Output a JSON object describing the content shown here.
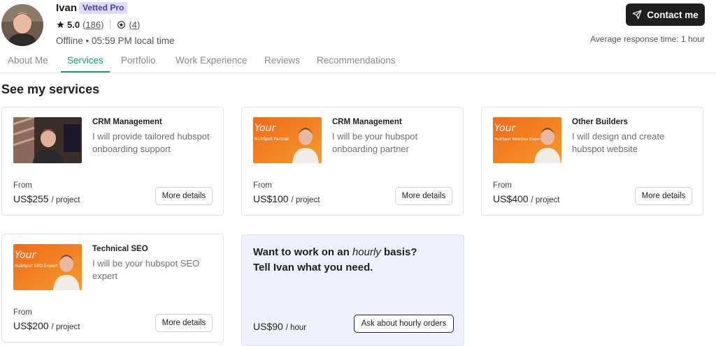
{
  "profile": {
    "name": "Ivan",
    "badge": "Vetted Pro",
    "rating": "5.0",
    "reviews_count": "(186)",
    "badges_count": "(4)",
    "status": "Offline • 05:59 PM local time",
    "contact_label": "Contact me",
    "response_time": "Average response time: 1 hour"
  },
  "tabs": [
    {
      "label": "About Me"
    },
    {
      "label": "Services",
      "active": true
    },
    {
      "label": "Portfolio"
    },
    {
      "label": "Work Experience"
    },
    {
      "label": "Reviews"
    },
    {
      "label": "Recommendations"
    }
  ],
  "section_title": "See my services",
  "services": [
    {
      "category": "CRM Management",
      "description": "I will provide tailored hubspot onboarding support",
      "from": "From",
      "price": "US$255",
      "unit": "/ project",
      "button": "More details",
      "thumb": "photo"
    },
    {
      "category": "CRM Management",
      "description": "I will be your hubspot onboarding partner",
      "from": "From",
      "price": "US$100",
      "unit": "/ project",
      "button": "More details",
      "thumb": "banner",
      "thumb_title": "Your",
      "thumb_subtitle": "HubSpot Partner"
    },
    {
      "category": "Other Builders",
      "description": "I will design and create hubspot website",
      "from": "From",
      "price": "US$400",
      "unit": "/ project",
      "button": "More details",
      "thumb": "banner",
      "thumb_title": "Your",
      "thumb_subtitle": "HubSpot WebDev Expert"
    },
    {
      "category": "Technical SEO",
      "description": "I will be your hubspot SEO expert",
      "from": "From",
      "price": "US$200",
      "unit": "/ project",
      "button": "More details",
      "thumb": "banner",
      "thumb_title": "Your",
      "thumb_subtitle": "HubSpot SEO Expert"
    }
  ],
  "hourly": {
    "line1_prefix": "Want to work on an",
    "line1_emphasis": "hourly",
    "line1_suffix": "basis?",
    "line2": "Tell Ivan what you need.",
    "rate": "US$90",
    "unit": "/ hour",
    "button": "Ask about hourly orders"
  },
  "colors": {
    "accent": "#13a06e",
    "badge_bg": "#dcdcf7",
    "dark_button": "#1f1f1f",
    "hourly_bg": "#eef1fb",
    "banner_orange": "#f26a1b"
  }
}
